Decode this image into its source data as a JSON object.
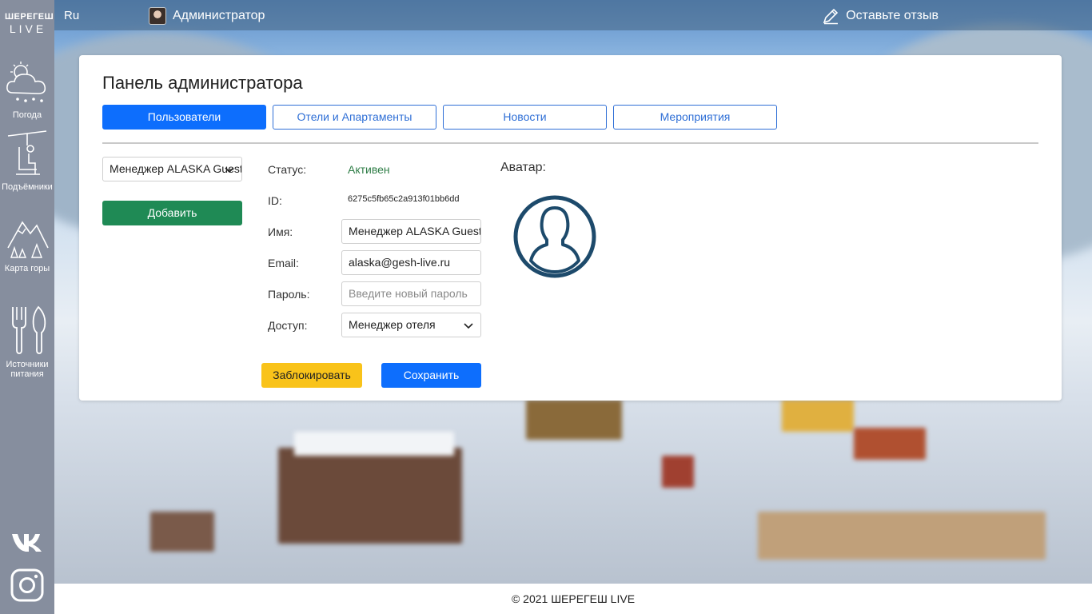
{
  "brand": {
    "top": "ШЕРЕГЕШ",
    "bottom": "LIVE"
  },
  "sidebar": {
    "items": [
      {
        "label": "Погода",
        "icon": "weather-icon"
      },
      {
        "label": "Подъёмники",
        "icon": "ski-lift-icon"
      },
      {
        "label": "Карта горы",
        "icon": "mountain-map-icon"
      },
      {
        "label": "Источники питания",
        "icon": "food-icon"
      }
    ],
    "social": [
      "vk-icon",
      "instagram-icon"
    ]
  },
  "topbar": {
    "lang": "Ru",
    "user": "Администратор",
    "feedback": "Оставьте отзыв"
  },
  "panel": {
    "title": "Панель администратора",
    "tabs": [
      "Пользователи",
      "Отели и Апартаменты",
      "Новости",
      "Мероприятия"
    ],
    "user_select": "Менеджер ALASKA Guest",
    "add_button": "Добавить",
    "fields": {
      "status_label": "Статус:",
      "status_value": "Активен",
      "id_label": "ID:",
      "id_value": "6275c5fb65c2a913f01bb6dd",
      "name_label": "Имя:",
      "name_value": "Менеджер ALASKA Guest",
      "email_label": "Email:",
      "email_value": "alaska@gesh-live.ru",
      "password_label": "Пароль:",
      "password_placeholder": "Введите новый пароль",
      "access_label": "Доступ:",
      "access_value": "Менеджер отеля"
    },
    "block_button": "Заблокировать",
    "save_button": "Сохранить",
    "avatar_label": "Аватар:"
  },
  "footer": "© 2021 ШЕРЕГЕШ LIVE",
  "colors": {
    "primary": "#0d6efd",
    "success": "#1f8a55",
    "warning": "#f9c31a",
    "sidebar": "#868e9e",
    "avatar_stroke": "#1d4a6b"
  }
}
